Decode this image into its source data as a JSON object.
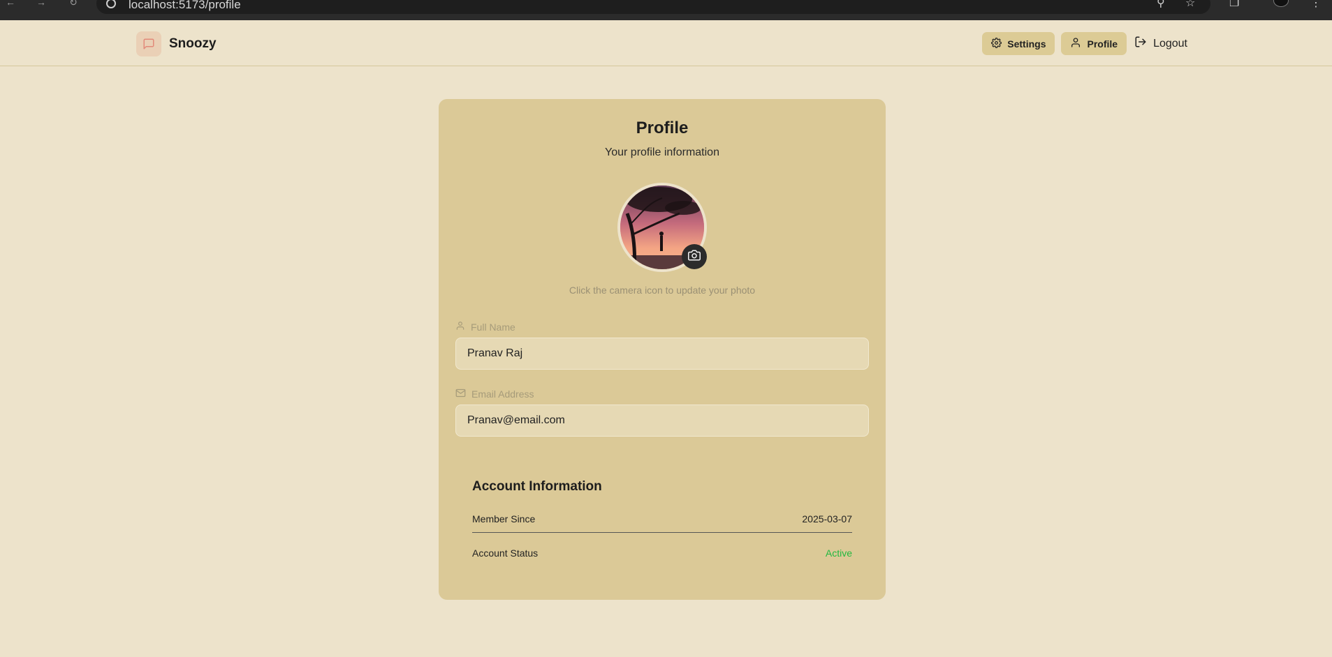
{
  "browser": {
    "url": "localhost:5173/profile"
  },
  "header": {
    "brand_name": "Snoozy",
    "settings_label": "Settings",
    "profile_label": "Profile",
    "logout_label": "Logout"
  },
  "profile": {
    "title": "Profile",
    "subtitle": "Your profile information",
    "avatar_hint": "Click the camera icon to update your photo",
    "full_name_label": "Full Name",
    "full_name_value": "Pranav Raj",
    "email_label": "Email Address",
    "email_value": "Pranav@email.com"
  },
  "account": {
    "title": "Account Information",
    "member_since_label": "Member Since",
    "member_since_value": "2025-03-07",
    "status_label": "Account Status",
    "status_value": "Active"
  },
  "colors": {
    "page_bg": "#ede3cb",
    "card_bg": "#dbc997",
    "status_active": "#22b83f"
  },
  "icons": {
    "brand": "chat-bubble-icon",
    "settings": "gear-icon",
    "profile": "user-icon",
    "logout": "logout-icon",
    "camera": "camera-icon",
    "full_name": "user-icon",
    "email": "mail-icon"
  }
}
